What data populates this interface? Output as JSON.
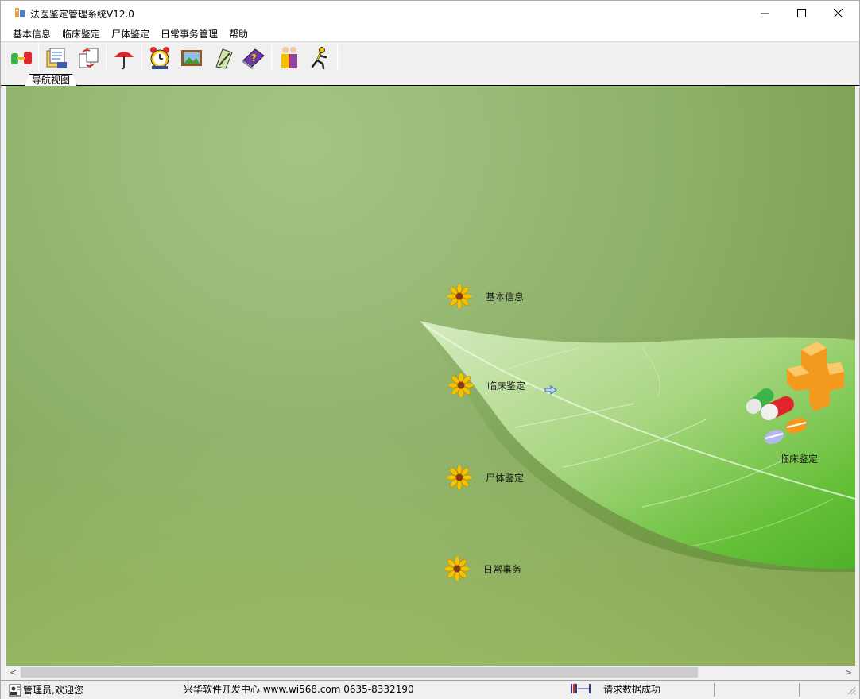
{
  "window": {
    "title": "法医鉴定管理系统V12.0",
    "controls": {
      "minimize": "—",
      "maximize": "☐",
      "close": "✕"
    }
  },
  "menubar": {
    "items": [
      "基本信息",
      "临床鉴定",
      "尸体鉴定",
      "日常事务管理",
      "帮助"
    ]
  },
  "toolbar": {
    "buttons": [
      {
        "icon": "connect-database-icon"
      },
      {
        "icon": "records-folder-icon"
      },
      {
        "icon": "document-transfer-icon"
      },
      {
        "icon": "umbrella-icon"
      },
      {
        "icon": "alarm-clock-icon"
      },
      {
        "icon": "picture-frame-icon"
      },
      {
        "icon": "notepad-pencil-icon"
      },
      {
        "icon": "help-book-icon"
      },
      {
        "icon": "users-icon"
      },
      {
        "icon": "exit-runner-icon"
      }
    ]
  },
  "tabs": {
    "nav_view": "导航视图"
  },
  "navigation": {
    "nodes": [
      {
        "label": "基本信息"
      },
      {
        "label": "临床鉴定"
      },
      {
        "label": "尸体鉴定"
      },
      {
        "label": "日常事务"
      }
    ],
    "selected_detail_label": "临床鉴定"
  },
  "scrollbar": {
    "left_arrow": "<",
    "right_arrow": ">"
  },
  "statusbar": {
    "user": "管理员,欢迎您",
    "company": "兴华软件开发中心 www.wi568.com 0635-8332190",
    "message": "请求数据成功"
  },
  "colors": {
    "canvas_green": "#8fb46b",
    "leaf_green": "#6cc63a",
    "flower_yellow": "#f6c200",
    "cross_orange": "#f39a1e"
  }
}
